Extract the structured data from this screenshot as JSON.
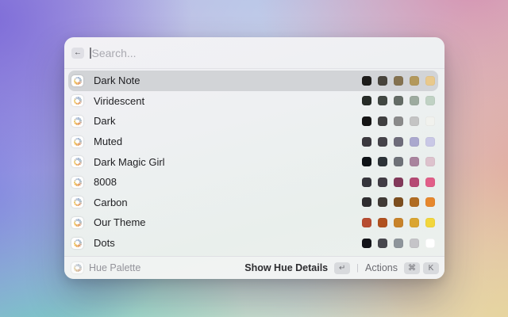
{
  "search": {
    "placeholder": "Search...",
    "back_icon": "←"
  },
  "list": {
    "selected_index": 0,
    "items": [
      {
        "label": "Dark Note",
        "colors": [
          "#1d1c1a",
          "#48443c",
          "#847250",
          "#b3995c",
          "#e9c98c"
        ]
      },
      {
        "label": "Viridescent",
        "colors": [
          "#262b27",
          "#414742",
          "#646c66",
          "#9dab9f",
          "#c0d2c4"
        ]
      },
      {
        "label": "Dark",
        "colors": [
          "#151515",
          "#404040",
          "#8a8a8a",
          "#c4c4c4",
          "#f1f2ee"
        ]
      },
      {
        "label": "Muted",
        "colors": [
          "#3b393f",
          "#454349",
          "#6e6c7a",
          "#aaa8ce",
          "#c9c8e6"
        ]
      },
      {
        "label": "Dark Magic Girl",
        "colors": [
          "#0e1216",
          "#2c3237",
          "#6e7178",
          "#a9849e",
          "#ddc2cd"
        ]
      },
      {
        "label": "8008",
        "colors": [
          "#35353c",
          "#413c44",
          "#82395a",
          "#b54a74",
          "#e15e88"
        ]
      },
      {
        "label": "Carbon",
        "colors": [
          "#2e2d2f",
          "#403a35",
          "#7c4e1e",
          "#b06c22",
          "#e6872c"
        ]
      },
      {
        "label": "Our Theme",
        "colors": [
          "#b74c31",
          "#b0511f",
          "#c8832a",
          "#daa531",
          "#f2d63c"
        ]
      },
      {
        "label": "Dots",
        "colors": [
          "#121318",
          "#47474d",
          "#8e959b",
          "#c5c4c8",
          "#ffffff"
        ]
      }
    ]
  },
  "footer": {
    "app_label": "Hue Palette",
    "primary_action": "Show Hue Details",
    "primary_key": "↵",
    "separator": "|",
    "secondary_action": "Actions",
    "secondary_keys": [
      "⌘",
      "K"
    ]
  },
  "colors": {
    "selection_highlight": "#d2d4d7",
    "window_background": "#eef0f0"
  },
  "icons": {
    "back": "arrow-left-icon",
    "row": "hue-ring-icon"
  }
}
